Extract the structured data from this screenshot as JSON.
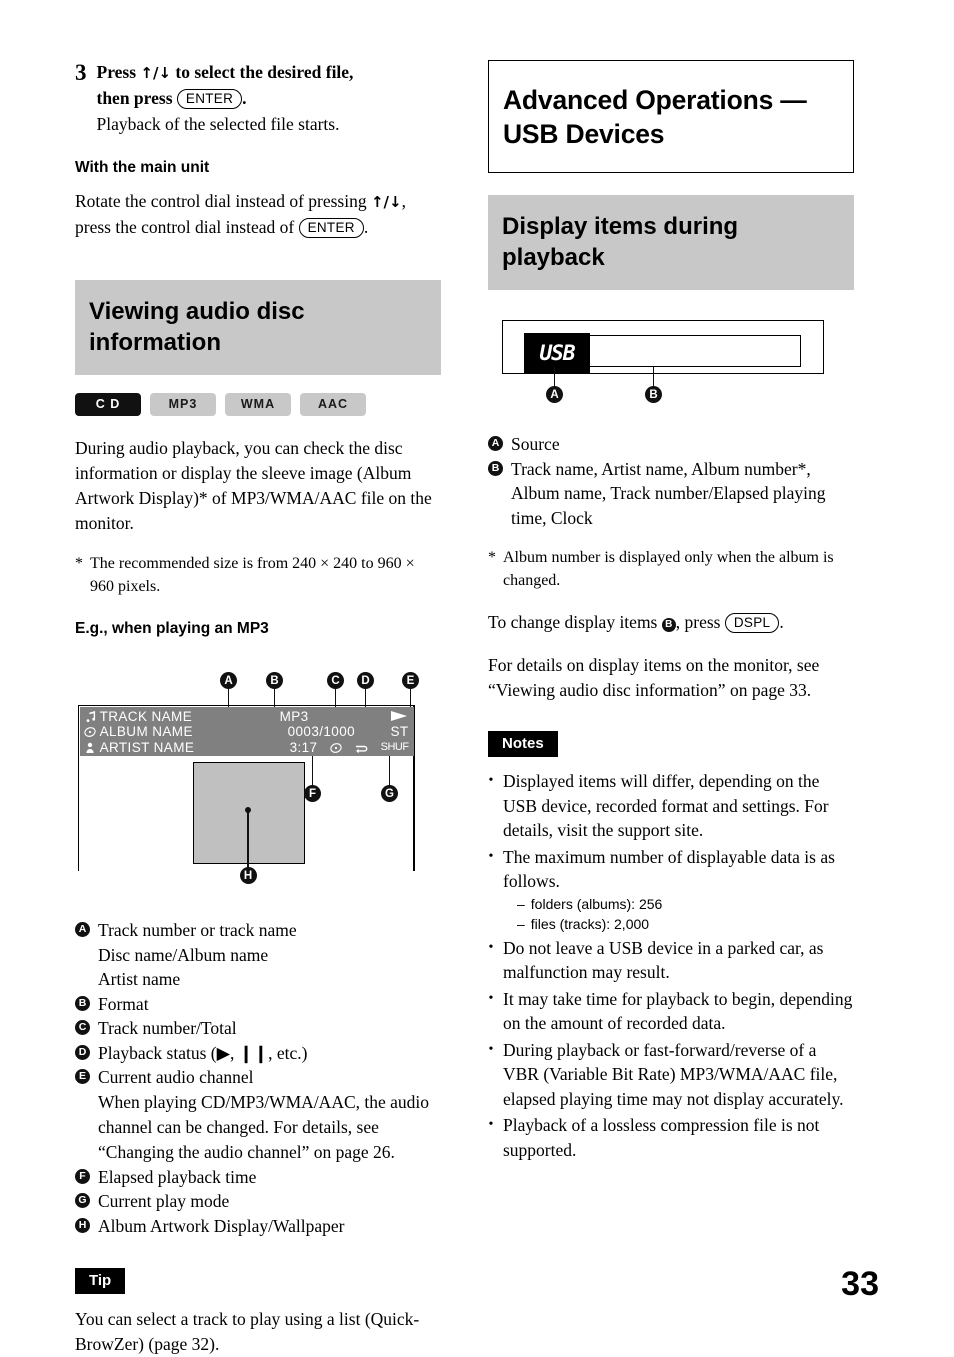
{
  "page_number": "33",
  "left": {
    "step": {
      "number": "3",
      "line1_a": "Press ",
      "arrows": "↑/↓",
      "line1_b": " to select the desired file,",
      "line2_a": "then press ",
      "enter_key": "ENTER",
      "line2_b": ".",
      "sub": "Playback of the selected file starts."
    },
    "main_unit": {
      "heading": "With the main unit",
      "text_a": "Rotate the control dial instead of pressing ",
      "arrows": "↑/↓",
      "text_b": ",",
      "text_c": "press the control dial instead of ",
      "enter_key": "ENTER",
      "text_d": "."
    },
    "section_title": "Viewing audio disc information",
    "badges": [
      {
        "label": "C D",
        "active": true
      },
      {
        "label": "MP3",
        "active": false
      },
      {
        "label": "WMA",
        "active": false
      },
      {
        "label": "AAC",
        "active": false
      }
    ],
    "intro": "During audio playback, you can check the disc information or display the sleeve image (Album Artwork Display)* of MP3/WMA/AAC file on the monitor.",
    "footnote": {
      "mark": "*",
      "text": "The recommended size is from 240 × 240 to 960 × 960 pixels."
    },
    "example_heading": "E.g., when playing an MP3",
    "monitor": {
      "track_name": "TRACK NAME",
      "album_name": "ALBUM NAME",
      "artist_name": "ARTIST NAME",
      "format": "MP3",
      "track_total": "0003/1000",
      "elapsed": "3:17",
      "channel": "ST",
      "play_mode": "SHUF",
      "markers": [
        "A",
        "B",
        "C",
        "D",
        "E",
        "F",
        "G",
        "H"
      ]
    },
    "legend": [
      {
        "letter": "A",
        "lines": [
          "Track number or track name",
          "Disc name/Album name",
          "Artist name"
        ]
      },
      {
        "letter": "B",
        "lines": [
          "Format"
        ]
      },
      {
        "letter": "C",
        "lines": [
          "Track number/Total"
        ]
      },
      {
        "letter": "D",
        "lines": [
          "Playback status (▶, ❙❙, etc.)"
        ]
      },
      {
        "letter": "E",
        "lines": [
          "Current audio channel"
        ],
        "cont": "When playing CD/MP3/WMA/AAC, the audio channel can be changed. For details, see “Changing the audio channel” on page 26."
      },
      {
        "letter": "F",
        "lines": [
          "Elapsed playback time"
        ]
      },
      {
        "letter": "G",
        "lines": [
          "Current play mode"
        ]
      },
      {
        "letter": "H",
        "lines": [
          "Album Artwork Display/Wallpaper"
        ]
      }
    ],
    "tip": {
      "tag": "Tip",
      "text": "You can select a track to play using a list (Quick-BrowZer) (page 32)."
    }
  },
  "right": {
    "chapter_title": "Advanced Operations — USB Devices",
    "section_title": "Display items during playback",
    "lcd": {
      "source_text": "USB",
      "markers": [
        "A",
        "B"
      ]
    },
    "items": [
      {
        "letter": "A",
        "text": "Source"
      },
      {
        "letter": "B",
        "text": "Track name, Artist name, Album number*, Album name, Track number/Elapsed playing time, Clock"
      }
    ],
    "footnote": {
      "mark": "*",
      "text": "Album number is displayed only when the album is changed."
    },
    "change_items": {
      "text_a": "To change display items ",
      "letter": "B",
      "text_b": ", press ",
      "key": "DSPL",
      "text_c": "."
    },
    "details": "For details on display items on the monitor, see “Viewing audio disc information” on page 33.",
    "notes_tag": "Notes",
    "notes": [
      {
        "text": "Displayed items will differ, depending on the USB device, recorded format and settings. For details, visit the support site."
      },
      {
        "text": "The maximum number of displayable data is as follows.",
        "sub": [
          "folders (albums): 256",
          "files (tracks): 2,000"
        ]
      },
      {
        "text": "Do not leave a USB device in a parked car, as malfunction may result."
      },
      {
        "text": "It may take time for playback to begin, depending on the amount of recorded data."
      },
      {
        "text": "During playback or fast-forward/reverse of a VBR (Variable Bit Rate) MP3/WMA/AAC file, elapsed playing time may not display accurately."
      },
      {
        "text": "Playback of a lossless compression file is not supported."
      }
    ]
  }
}
